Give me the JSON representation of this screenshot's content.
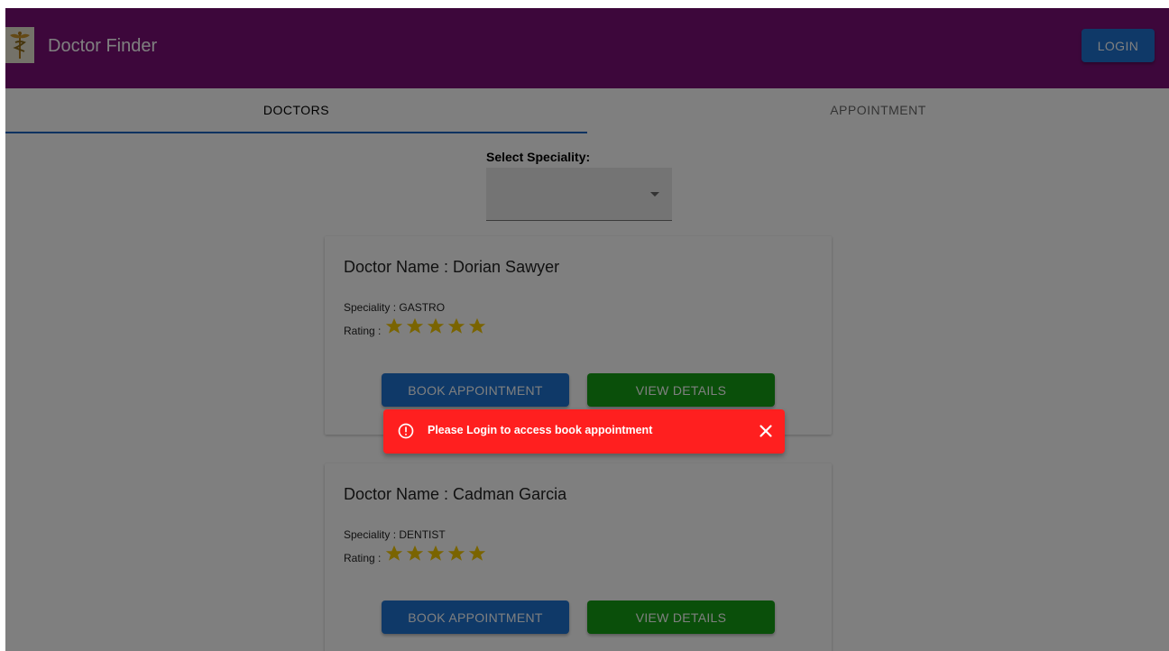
{
  "header": {
    "title": "Doctor Finder",
    "login_label": "LOGIN"
  },
  "tabs": [
    {
      "label": "DOCTORS",
      "active": true
    },
    {
      "label": "APPOINTMENT",
      "active": false
    }
  ],
  "filter": {
    "label": "Select Speciality:",
    "selected_value": ""
  },
  "doctors": [
    {
      "name_text": "Doctor Name : Dorian Sawyer",
      "speciality_text": "Speciality : GASTRO",
      "rating_label": "Rating :",
      "rating": 5,
      "rating_max": 5,
      "book_label": "BOOK APPOINTMENT",
      "view_label": "VIEW DETAILS"
    },
    {
      "name_text": "Doctor Name : Cadman Garcia",
      "speciality_text": "Speciality : DENTIST",
      "rating_label": "Rating :",
      "rating": 5,
      "rating_max": 5,
      "book_label": "BOOK APPOINTMENT",
      "view_label": "VIEW DETAILS"
    }
  ],
  "snackbar": {
    "message": "Please Login to access book appointment"
  },
  "colors": {
    "appbar": "#7a0f76",
    "primary_button": "#1e73d0",
    "success_button": "#149e14",
    "error_snackbar": "#ff1f1f",
    "star": "#f5c800"
  },
  "icons": {
    "logo": "caduceus-icon",
    "snackbar": "error-outline-icon",
    "close": "close-icon",
    "select": "caret-down-icon",
    "rating": "star-icon"
  }
}
